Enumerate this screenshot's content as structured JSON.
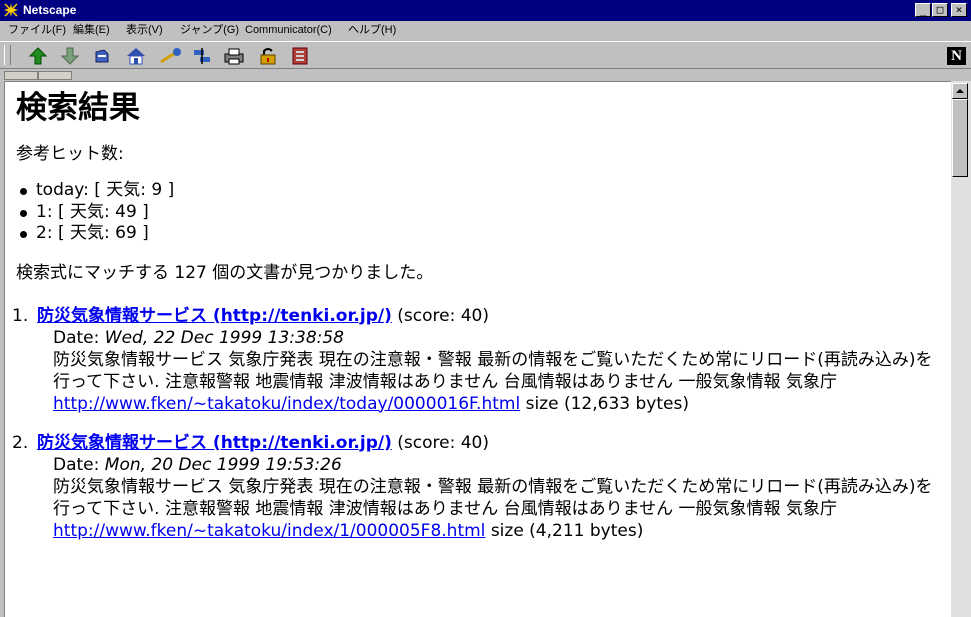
{
  "window": {
    "title": "Netscape",
    "controls": {
      "minimize": "_",
      "maximize": "□",
      "close": "×"
    }
  },
  "menu": [
    {
      "label": "ファイル(F)"
    },
    {
      "label": "編集(E)"
    },
    {
      "label": "表示(V)"
    },
    {
      "label": "ジャンプ(G)"
    },
    {
      "label": "Communicator(C)"
    },
    {
      "label": "ヘルプ(H)"
    }
  ],
  "toolbar": {
    "icons": [
      "back-icon",
      "forward-icon",
      "reload-icon",
      "home-icon",
      "search-icon",
      "guide-icon",
      "print-icon",
      "security-icon",
      "stop-icon"
    ],
    "brand": "N"
  },
  "page": {
    "heading": "検索結果",
    "hits_label": "参考ヒット数:",
    "hits": [
      {
        "term": "today",
        "detail": ": [ 天気: 9 ]"
      },
      {
        "term": "1",
        "detail": ": [ 天気: 49 ]"
      },
      {
        "term": "2",
        "detail": ": [ 天気: 69 ]"
      }
    ],
    "summary": "検索式にマッチする 127 個の文書が見つかりました。",
    "results": [
      {
        "number": "1.",
        "title": "防災気象情報サービス (http://tenki.or.jp/)",
        "score": "(score: 40)",
        "date_label": "Date:",
        "date": "Wed, 22 Dec 1999 13:38:58",
        "snippet": "防災気象情報サービス 気象庁発表 現在の注意報・警報 最新の情報をご覧いただくため常にリロード(再読み込み)を行って下さい. 注意報警報 地震情報 津波情報はありません 台風情報はありません 一般気象情報 気象庁",
        "url": "http://www.fken/~takatoku/index/today/0000016F.html",
        "size": "size (12,633 bytes)"
      },
      {
        "number": "2.",
        "title": "防災気象情報サービス (http://tenki.or.jp/)",
        "score": "(score: 40)",
        "date_label": "Date:",
        "date": "Mon, 20 Dec 1999 19:53:26",
        "snippet": "防災気象情報サービス 気象庁発表 現在の注意報・警報 最新の情報をご覧いただくため常にリロード(再読み込み)を行って下さい. 注意報警報 地震情報 津波情報はありません 台風情報はありません 一般気象情報 気象庁",
        "url": "http://www.fken/~takatoku/index/1/000005F8.html",
        "size": "size (4,211 bytes)"
      }
    ]
  },
  "colors": {
    "titlebar": "#000080",
    "link": "#0000ee",
    "chrome": "#c0c0c0"
  }
}
